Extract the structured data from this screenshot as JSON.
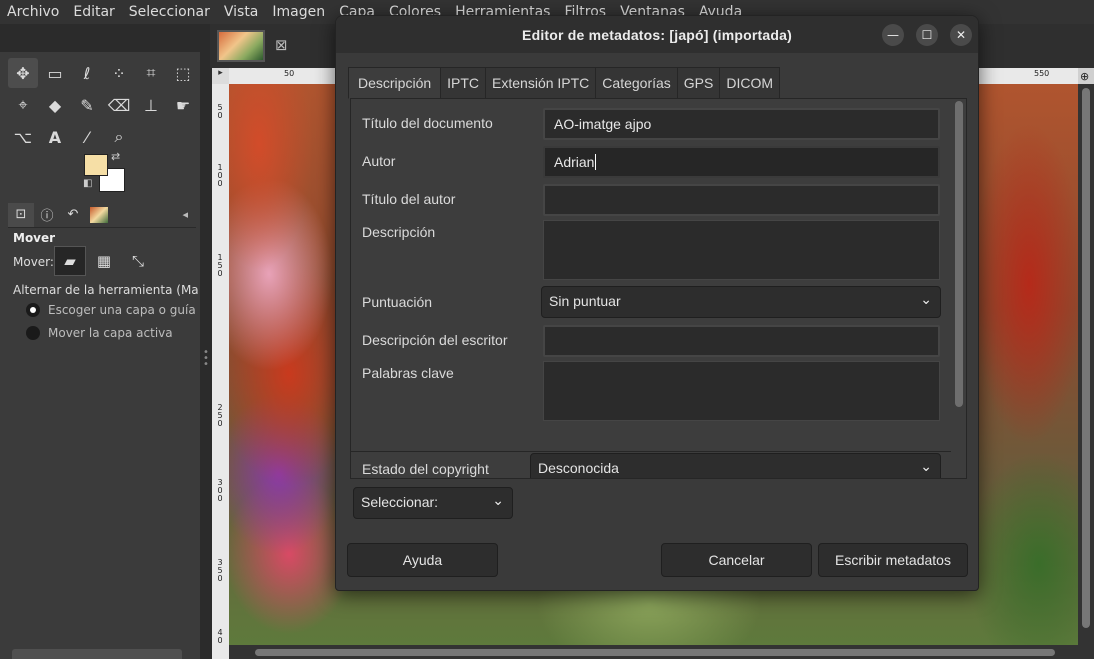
{
  "menubar": {
    "items": [
      "Archivo",
      "Editar",
      "Seleccionar",
      "Vista",
      "Imagen",
      "Capa",
      "Colores",
      "Herramientas",
      "Filtros",
      "Ventanas",
      "Ayuda"
    ]
  },
  "toolbox": {
    "tools": [
      "move-icon",
      "rect-select-icon",
      "lasso-icon",
      "fuzzy-select-icon",
      "crop-icon",
      "transform-icon",
      "warp-icon",
      "bucket-fill-icon",
      "paintbrush-icon",
      "eraser-icon",
      "clone-icon",
      "smudge-icon",
      "paths-icon",
      "text-icon",
      "color-picker-icon",
      "zoom-icon"
    ],
    "fg_color": "#f6dfa6",
    "bg_color": "#ffffff"
  },
  "tool_options": {
    "title": "Mover",
    "mover_label": "Mover:",
    "toggle_label": "Alternar de la herramienta  (Mayú",
    "radio_options": [
      {
        "label": "Escoger una capa o guía",
        "selected": true
      },
      {
        "label": "Mover la capa activa",
        "selected": false
      }
    ]
  },
  "image_tab": {
    "close_symbol": "⊠"
  },
  "ruler": {
    "top_left_label": "50",
    "top_right_label": "550"
  },
  "dialog": {
    "title": "Editor de metadatos: [japó] (importada)",
    "tabs": [
      "Descripción",
      "IPTC",
      "Extensión IPTC",
      "Categorías",
      "GPS",
      "DICOM"
    ],
    "active_tab": "Descripción",
    "fields": {
      "document_title_label": "Título del documento",
      "document_title_value": "AO-imatge ajpo",
      "author_label": "Autor",
      "author_value": "Adrian",
      "author_title_label": "Título del autor",
      "author_title_value": "",
      "description_label": "Descripción",
      "rating_label": "Puntuación",
      "rating_value": "Sin puntuar",
      "writer_description_label": "Descripción del escritor",
      "writer_description_value": "",
      "keywords_label": "Palabras clave",
      "copyright_status_label": "Estado del copyright",
      "copyright_status_value": "Desconocida"
    },
    "select_combo": "Seleccionar:",
    "buttons": {
      "help": "Ayuda",
      "cancel": "Cancelar",
      "write": "Escribir metadatos"
    }
  }
}
